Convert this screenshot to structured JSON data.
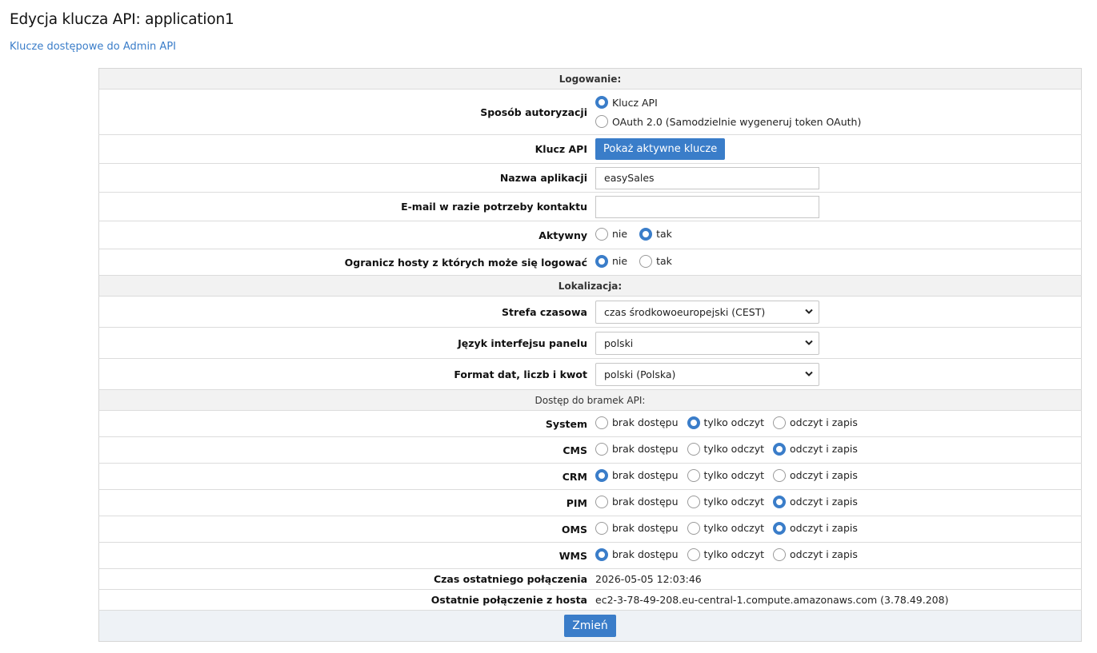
{
  "page": {
    "title": "Edycja klucza API: application1",
    "back_link": "Klucze dostępowe do Admin API"
  },
  "sections": {
    "login": "Logowanie:",
    "localization": "Lokalizacja:",
    "gateways": "Dostęp do bramek API:"
  },
  "auth": {
    "label": "Sposób autoryzacji",
    "options": [
      "Klucz API",
      "OAuth 2.0 (Samodzielnie wygeneruj token OAuth)"
    ],
    "selected": 0
  },
  "api_key": {
    "label": "Klucz API",
    "button": "Pokaż aktywne klucze"
  },
  "app_name": {
    "label": "Nazwa aplikacji",
    "value": "easySales",
    "placeholder": ""
  },
  "email": {
    "label": "E-mail w razie potrzeby kontaktu",
    "value": "",
    "placeholder": ""
  },
  "active": {
    "label": "Aktywny",
    "options": [
      "nie",
      "tak"
    ],
    "selected": 1
  },
  "restrict_hosts": {
    "label": "Ogranicz hosty z których może się logować",
    "options": [
      "nie",
      "tak"
    ],
    "selected": 0
  },
  "timezone": {
    "label": "Strefa czasowa",
    "value": "czas środkowoeuropejski (CEST)"
  },
  "language": {
    "label": "Język interfejsu panelu",
    "value": "polski"
  },
  "format": {
    "label": "Format dat, liczb i kwot",
    "value": "polski (Polska)"
  },
  "access_options": [
    "brak dostępu",
    "tylko odczyt",
    "odczyt i zapis"
  ],
  "gateways": [
    {
      "name": "System",
      "selected": 1
    },
    {
      "name": "CMS",
      "selected": 2
    },
    {
      "name": "CRM",
      "selected": 0
    },
    {
      "name": "PIM",
      "selected": 2
    },
    {
      "name": "OMS",
      "selected": 2
    },
    {
      "name": "WMS",
      "selected": 0
    }
  ],
  "last_connection": {
    "label": "Czas ostatniego połączenia",
    "value": "2026-05-05 12:03:46"
  },
  "last_host": {
    "label": "Ostatnie połączenie z hosta",
    "value": "ec2-3-78-49-208.eu-central-1.compute.amazonaws.com (3.78.49.208)"
  },
  "submit": {
    "label": "Zmień"
  },
  "colors": {
    "accent": "#3a7dc9",
    "section_bg": "#f2f2f2",
    "footer_bg": "#eef2f6"
  }
}
